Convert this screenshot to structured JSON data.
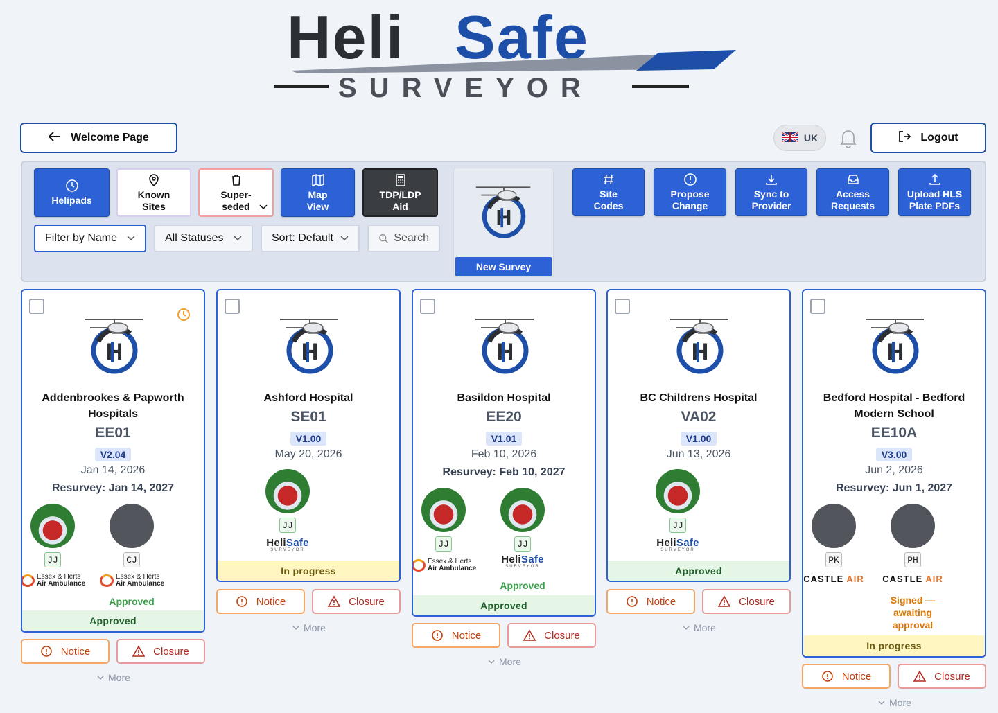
{
  "brand": {
    "line1_dark": "Heli",
    "line1_blue": "Safe",
    "line2": "SURVEYOR"
  },
  "header": {
    "welcome_label": "Welcome Page",
    "region_label": "UK",
    "logout_label": "Logout"
  },
  "toolbar": {
    "helipads": "Helipads",
    "known_sites_1": "Known",
    "known_sites_2": "Sites",
    "superseded_1": "Super-",
    "superseded_2": "seded",
    "map_1": "Map",
    "map_2": "View",
    "tdp_1": "TDP/LDP",
    "tdp_2": "Aid",
    "new_survey": "New Survey",
    "site_codes_1": "Site",
    "site_codes_2": "Codes",
    "propose_1": "Propose",
    "propose_2": "Change",
    "sync_1": "Sync to",
    "sync_2": "Provider",
    "access_1": "Access",
    "access_2": "Requests",
    "upload_1": "Upload HLS",
    "upload_2": "Plate PDFs",
    "filter_by": "Filter by Name",
    "status_filter": "All Statuses",
    "sort": "Sort: Default",
    "search_placeholder": "Search"
  },
  "colors": {
    "primary": "#2d62d6",
    "approved": "#3aa34a",
    "in_progress": "#fff6c2",
    "danger": "#b02a1f"
  },
  "actions": {
    "notice": "Notice",
    "closure": "Closure",
    "more": "More"
  },
  "cards": [
    {
      "name1": "Addenbrookes & Papworth",
      "name2": "Hospitals",
      "code": "EE01",
      "version": "V2.04",
      "date": "Jan 14, 2026",
      "resurvey": "Resurvey: Jan 14, 2027",
      "surveyors": [
        {
          "initials": "JJ",
          "org": "Essex & Herts Air Ambulance"
        },
        {
          "initials": "CJ",
          "org": "Essex & Herts Air Ambulance",
          "sub_status": "Approved"
        }
      ],
      "status": "Approved"
    },
    {
      "name1": "Ashford Hospital",
      "code": "SE01",
      "version": "V1.00",
      "date": "May 20, 2026",
      "surveyors": [
        {
          "initials": "JJ",
          "org": "HeliSafe"
        }
      ],
      "status": "In progress"
    },
    {
      "name1": "Basildon Hospital",
      "code": "EE20",
      "version": "V1.01",
      "date": "Feb 10, 2026",
      "resurvey": "Resurvey: Feb 10, 2027",
      "surveyors": [
        {
          "initials": "JJ",
          "org": "Essex & Herts Air Ambulance"
        },
        {
          "initials": "JJ",
          "org": "HeliSafe",
          "sub_status": "Approved"
        }
      ],
      "status": "Approved"
    },
    {
      "name1": "BC Childrens Hospital",
      "code": "VA02",
      "version": "V1.00",
      "date": "Jun 13, 2026",
      "surveyors": [
        {
          "initials": "JJ",
          "org": "HeliSafe"
        }
      ],
      "status": "Approved"
    },
    {
      "name1": "Bedford Hospital - Bedford",
      "name2": "Modern School",
      "code": "EE10A",
      "version": "V3.00",
      "date": "Jun 2, 2026",
      "resurvey": "Resurvey: Jun 1, 2027",
      "surveyors": [
        {
          "initials": "PK",
          "org": "Castle Air"
        },
        {
          "initials": "PH",
          "org": "Castle Air",
          "sub_status": "Signed — awaiting approval"
        }
      ],
      "status": "In progress"
    }
  ]
}
